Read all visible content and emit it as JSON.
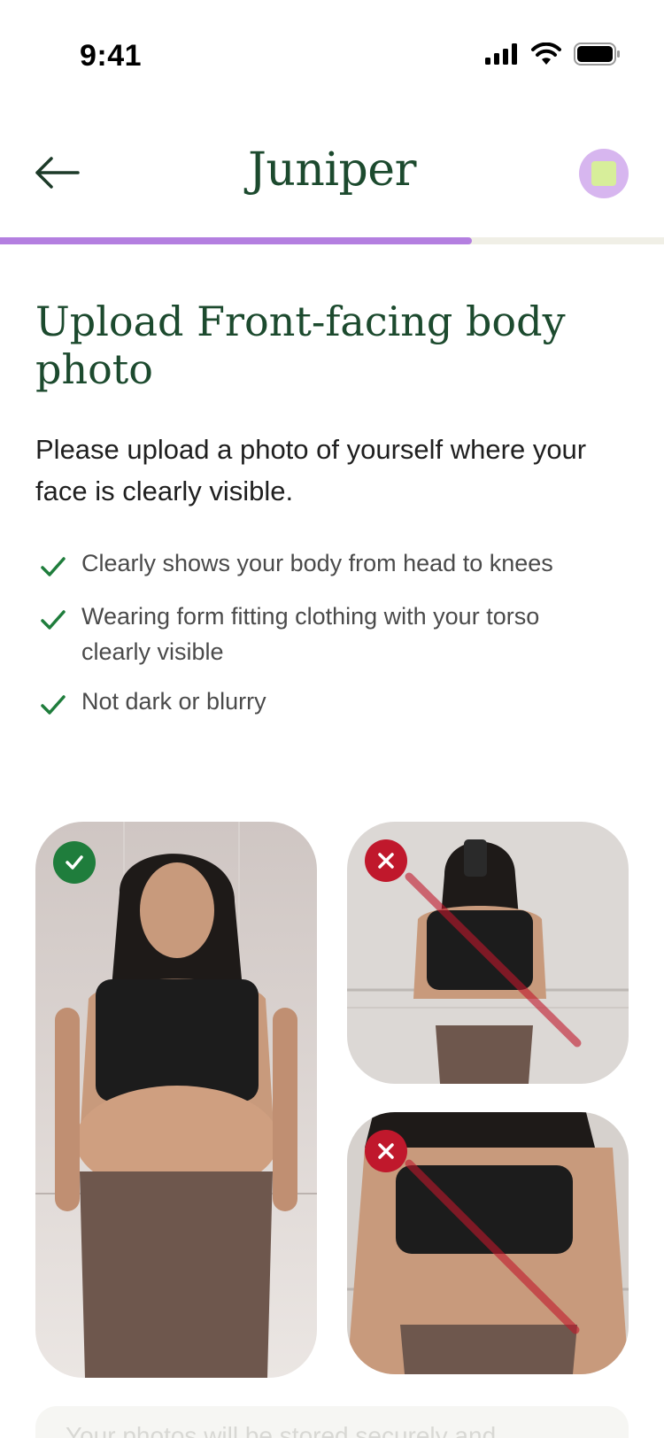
{
  "status_bar": {
    "time": "9:41"
  },
  "header": {
    "logo": "Juniper"
  },
  "progress": {
    "fraction": 0.71
  },
  "page": {
    "title": "Upload Front-facing body photo",
    "subtitle": "Please upload a photo of yourself where your face is clearly visible.",
    "requirements": [
      "Clearly shows your body from head to knees",
      "Wearing form fitting clothing with your torso clearly visible",
      "Not dark or blurry"
    ]
  },
  "examples": [
    {
      "kind": "good",
      "icon": "check-badge-icon"
    },
    {
      "kind": "bad",
      "icon": "cross-badge-icon"
    },
    {
      "kind": "bad",
      "icon": "cross-badge-icon"
    }
  ],
  "privacy_note": "Your photos will be stored securely and",
  "colors": {
    "brand_green": "#1c4a2e",
    "progress_purple": "#b47fe0",
    "good_green": "#1f7d3c",
    "bad_red": "#c0182c",
    "avatar_lilac": "#d7b6ef"
  }
}
